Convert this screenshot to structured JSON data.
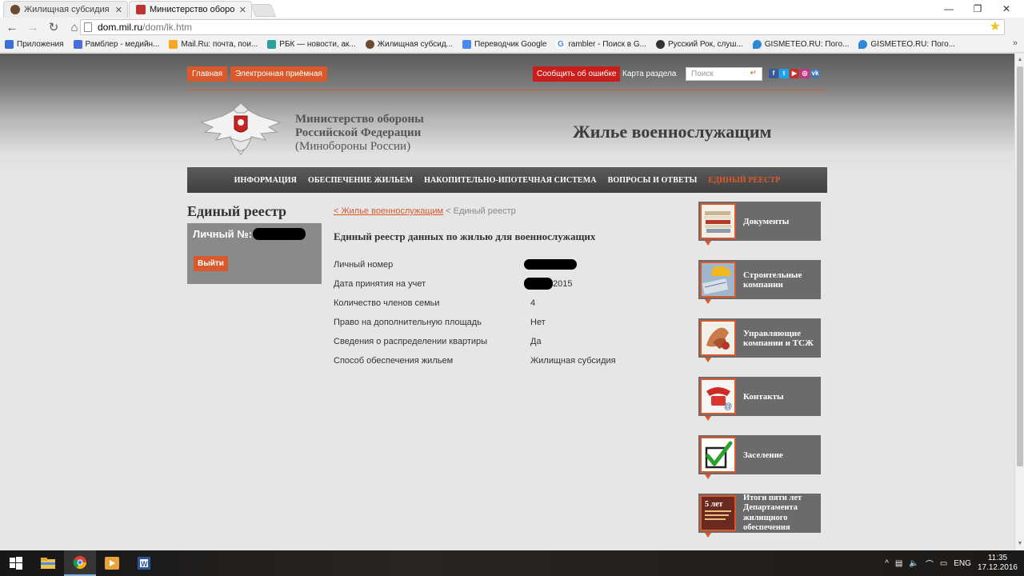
{
  "browser": {
    "tabs": [
      {
        "title": "Жилищная субсидия для",
        "active": false
      },
      {
        "title": "Министерство обороны",
        "active": true
      }
    ],
    "url_host": "dom.mil.ru",
    "url_path": "/dom/lk.htm",
    "bookmarks": [
      "Приложения",
      "Рамблер - медийн...",
      "Mail.Ru: почта, пои...",
      "РБК — новости, ак...",
      "Жилищная субсид...",
      "Переводчик Google",
      "rambler - Поиск в G...",
      "Русский Рок, слуш...",
      "GISMETEO.RU: Пого...",
      "GISMETEO.RU: Пого..."
    ],
    "bookmark_colors": [
      "#3b6fd9",
      "#4a6ee0",
      "#f5a623",
      "#2aa0a0",
      "#6b4a2f",
      "#4a87f0",
      "#4285f4",
      "#333333",
      "#2d89d8",
      "#2d89d8"
    ]
  },
  "header": {
    "top_links": [
      "Главная",
      "Электронная приёмная"
    ],
    "report_error": "Сообщить об ошибке",
    "sitemap": "Карта раздела",
    "search_placeholder": "Поиск",
    "ministry_line1": "Министерство обороны",
    "ministry_line2": "Российской Федерации",
    "ministry_line3": "(Минобороны России)",
    "site_title": "Жилье военнослужащим"
  },
  "nav": {
    "items": [
      {
        "label": "Информация",
        "active": false
      },
      {
        "label": "Обеспечение жильем",
        "active": false
      },
      {
        "label": "Накопительно-ипотечная система",
        "active": false
      },
      {
        "label": "Вопросы и ответы",
        "active": false
      },
      {
        "label": "Единый реестр",
        "active": true
      }
    ]
  },
  "sidebar_left": {
    "title": "Единый реестр",
    "personal_label": "Личный №:",
    "logout": "Выйти"
  },
  "breadcrumb": {
    "link": "< Жилье военнослужащим",
    "current": "< Единый реестр"
  },
  "content": {
    "title": "Единый реестр данных по жилью для военнослужащих",
    "rows": [
      {
        "label": "Личный номер",
        "value": ""
      },
      {
        "label": "Дата принятия на учет",
        "value": "2015"
      },
      {
        "label": "Количество членов семьи",
        "value": "4"
      },
      {
        "label": "Право на дополнительную площадь",
        "value": "Нет"
      },
      {
        "label": "Сведения о распределении квартиры",
        "value": "Да"
      },
      {
        "label": "Способ обеспечения жильем",
        "value": "Жилищная субсидия"
      }
    ]
  },
  "side_cards": [
    {
      "label": "Документы",
      "icon": "documents-icon"
    },
    {
      "label": "Строительные компании",
      "icon": "construction-icon"
    },
    {
      "label": "Управляющие компании и ТСЖ",
      "icon": "handshake-icon"
    },
    {
      "label": "Контакты",
      "icon": "phone-icon"
    },
    {
      "label": "Заселение",
      "icon": "checkmark-icon"
    },
    {
      "label": "Итоги пяти лет Департамента жилищного обеспечения",
      "icon": "five-years-icon"
    }
  ],
  "five_years_badge": "5 лет",
  "taskbar": {
    "lang": "ENG",
    "time": "11:35",
    "date": "17.12.2016"
  },
  "colors": {
    "accent": "#d9592c",
    "error_red": "#cc1d1d",
    "card_bg": "#6b6b6b"
  }
}
